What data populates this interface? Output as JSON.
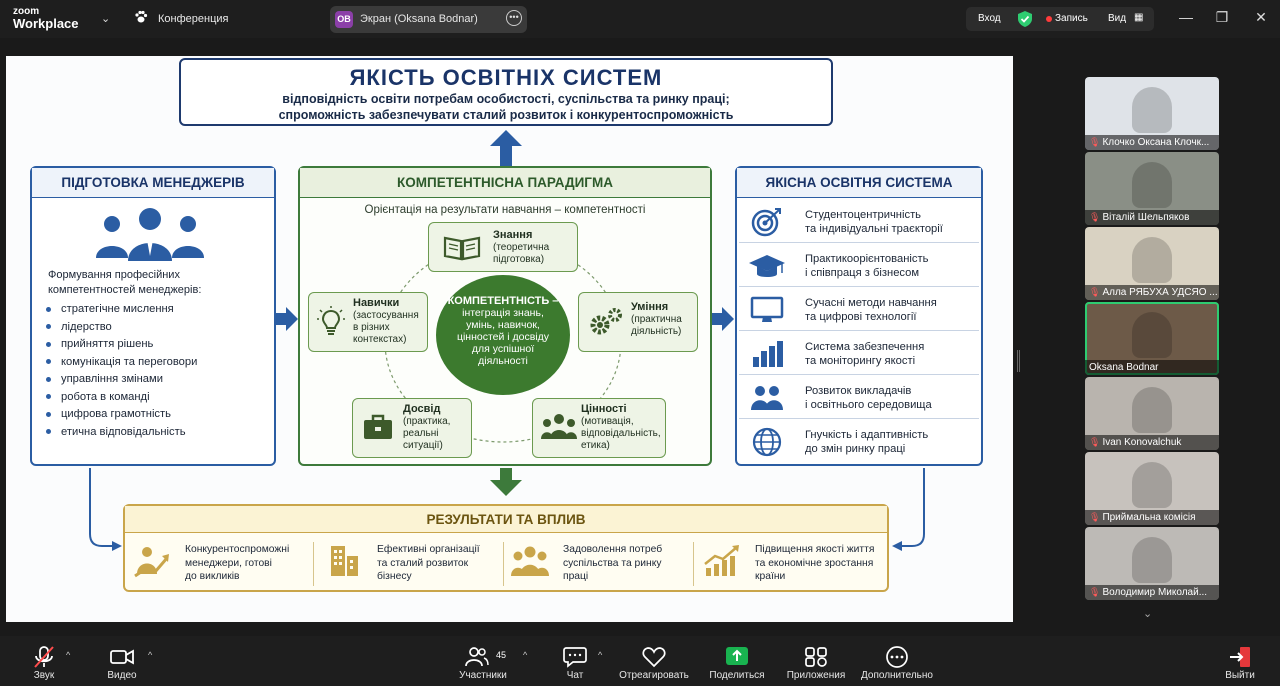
{
  "app": {
    "logo_top": "zoom",
    "logo_bottom": "Workplace",
    "meeting_name": "Конференция",
    "screen_share": {
      "initials": "OB",
      "label": "Экран (Oksana Bodnar)"
    },
    "right": {
      "signin": "Вход",
      "record": "Запись",
      "view": "Вид"
    }
  },
  "slide": {
    "header": {
      "title": "ЯКІСТЬ ОСВІТНІХ СИСТЕМ",
      "line1": "відповідність освіти потребам особистості, суспільства та ринку праці;",
      "line2": "спроможність забезпечувати сталий розвиток і конкурентоспроможність"
    },
    "managers": {
      "title": "ПІДГОТОВКА МЕНЕДЖЕРІВ",
      "heading1": "Формування професійних",
      "heading2": "компетентностей менеджерів:",
      "items": [
        "стратегічне мислення",
        "лідерство",
        "прийняття рішень",
        "комунікація та переговори",
        "управління змінами",
        "робота в команді",
        "цифрова грамотність",
        "етична відповідальність"
      ]
    },
    "paradigm": {
      "title": "КОМПЕТЕНТНІСНА ПАРАДИГМА",
      "orientation": "Орієнтація на результати навчання – компетентності",
      "center": {
        "title": "КОМПЕТЕНТНІСТЬ –",
        "l1": "інтеграція знань,",
        "l2": "умінь, навичок,",
        "l3": "цінностей і досвіду",
        "l4": "для успішної",
        "l5": "діяльності"
      },
      "knowledge": {
        "title": "Знання",
        "l1": "(теоретична",
        "l2": "підготовка)"
      },
      "skills_left": {
        "title": "Навички",
        "l1": "(застосування",
        "l2": "в різних",
        "l3": "контекстах)"
      },
      "skills_right": {
        "title": "Уміння",
        "l1": "(практична",
        "l2": "діяльність)"
      },
      "experience": {
        "title": "Досвід",
        "l1": "(практика,",
        "l2": "реальні",
        "l3": "ситуації)"
      },
      "values": {
        "title": "Цінності",
        "l1": "(мотивація,",
        "l2": "відповідальність,",
        "l3": "етика)"
      }
    },
    "quality": {
      "title": "ЯКІСНА ОСВІТНЯ СИСТЕМА",
      "rows": [
        {
          "icon": "target-icon",
          "l1": "Студентоцентричність",
          "l2": "та індивідуальні траєкторії"
        },
        {
          "icon": "graduation-cap-icon",
          "l1": "Практикоорієнтованість",
          "l2": "і співпраця з бізнесом"
        },
        {
          "icon": "monitor-icon",
          "l1": "Сучасні методи навчання",
          "l2": "та цифрові технології"
        },
        {
          "icon": "bar-chart-icon",
          "l1": "Система забезпечення",
          "l2": "та моніторингу якості"
        },
        {
          "icon": "people-icon",
          "l1": "Розвиток викладачів",
          "l2": "і освітнього середовища"
        },
        {
          "icon": "globe-icon",
          "l1": "Гнучкість і адаптивність",
          "l2": "до змін ринку праці"
        }
      ]
    },
    "results": {
      "title": "РЕЗУЛЬТАТИ ТА ВПЛИВ",
      "items": [
        {
          "icon": "growth-person-icon",
          "l1": "Конкурентоспроможні",
          "l2": "менеджери, готові",
          "l3": "до викликів"
        },
        {
          "icon": "buildings-icon",
          "l1": "Ефективні організації",
          "l2": "та сталий розвиток",
          "l3": "бізнесу"
        },
        {
          "icon": "group-icon",
          "l1": "Задоволення потреб",
          "l2": "суспільства та ринку",
          "l3": "праці"
        },
        {
          "icon": "trend-up-icon",
          "l1": "Підвищення якості життя",
          "l2": "та економічне зростання",
          "l3": "країни"
        }
      ]
    }
  },
  "participants": [
    {
      "name": "Клочко Оксана Клочк...",
      "muted": true,
      "bg": "#dfe3e8"
    },
    {
      "name": "Віталій Шельпяков",
      "muted": true,
      "bg": "#8a8f86"
    },
    {
      "name": "Алла РЯБУХА УДСЯО ...",
      "muted": true,
      "bg": "#d9d2c2"
    },
    {
      "name": "Oksana Bodnar",
      "muted": false,
      "bg": "#6d5a48"
    },
    {
      "name": "Ivan Konovalchuk",
      "muted": true,
      "bg": "#b9b4ae"
    },
    {
      "name": "Приймальна комісія",
      "muted": true,
      "bg": "#c7c2bd"
    },
    {
      "name": "Володимир Миколай...",
      "muted": true,
      "bg": "#bdbab6"
    }
  ],
  "toolbar": {
    "audio": "Звук",
    "video": "Видео",
    "participants": "Участники",
    "participants_count": "45",
    "chat": "Чат",
    "react": "Отреагировать",
    "share": "Поделиться",
    "apps": "Приложения",
    "more": "Дополнительно",
    "leave": "Выйти"
  },
  "colors": {
    "accent_green": "#2ecc71",
    "share_green": "#19b350",
    "leave_red": "#e5383b"
  }
}
